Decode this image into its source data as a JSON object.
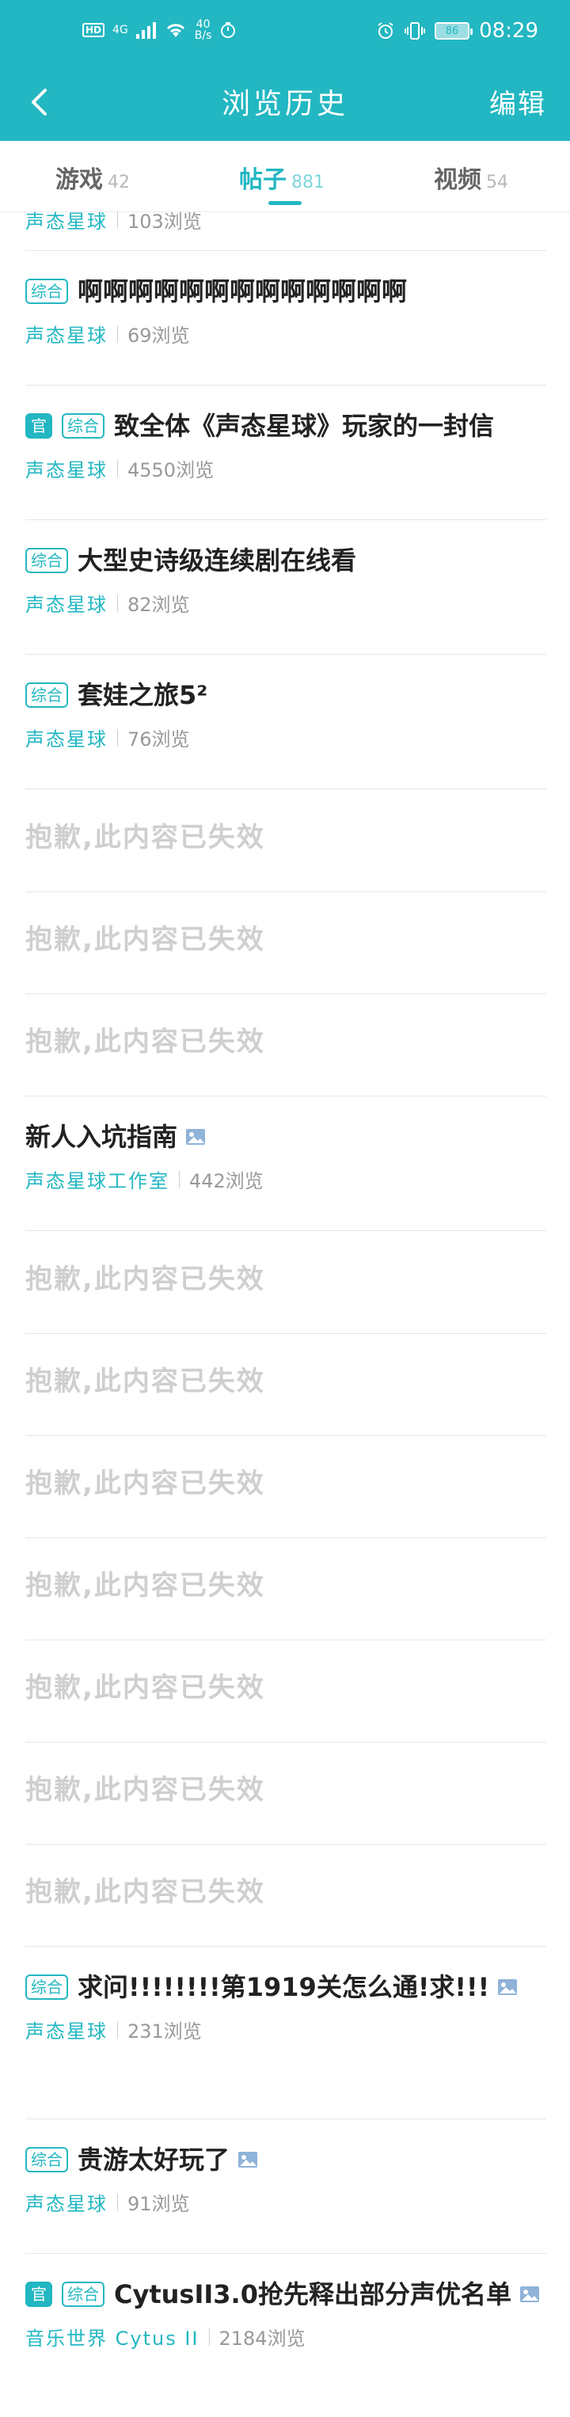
{
  "status_bar": {
    "hd": "HD",
    "signal": "4G",
    "speed_value": "40",
    "speed_unit": "B/s",
    "battery": "86",
    "time": "08:29"
  },
  "header": {
    "title": "浏览历史",
    "edit_label": "编辑"
  },
  "tabs": [
    {
      "label": "游戏",
      "count": "42"
    },
    {
      "label": "帖子",
      "count": "881"
    },
    {
      "label": "视频",
      "count": "54"
    }
  ],
  "active_tab": "帖子",
  "unavailable_text": "抱歉,此内容已失效",
  "posts": [
    {
      "source": "声态星球",
      "views": "103浏览"
    },
    {
      "tags": [
        "综合"
      ],
      "title": "啊啊啊啊啊啊啊啊啊啊啊啊啊",
      "source": "声态星球",
      "views": "69浏览"
    },
    {
      "tags": [
        "官",
        "综合"
      ],
      "title": "致全体《声态星球》玩家的一封信",
      "source": "声态星球",
      "views": "4550浏览"
    },
    {
      "tags": [
        "综合"
      ],
      "title": "大型史诗级连续剧在线看",
      "source": "声态星球",
      "views": "82浏览"
    },
    {
      "tags": [
        "综合"
      ],
      "title": "套娃之旅5²",
      "source": "声态星球",
      "views": "76浏览"
    },
    {
      "title": "新人入坑指南",
      "has_image": true,
      "source": "声态星球工作室",
      "views": "442浏览"
    },
    {
      "tags": [
        "综合"
      ],
      "title": "求问!!!!!!!!第1919关怎么通!求!!!",
      "has_image": true,
      "source": "声态星球",
      "views": "231浏览"
    },
    {
      "tags": [
        "综合"
      ],
      "title": "贵游太好玩了",
      "has_image": true,
      "source": "声态星球",
      "views": "91浏览"
    },
    {
      "tags": [
        "官",
        "综合"
      ],
      "title": "CytusII3.0抢先释出部分声优名单",
      "has_image": true,
      "source": "音乐世界 Cytus II",
      "views": "2184浏览"
    }
  ],
  "colors": {
    "accent": "#22b7c2",
    "muted": "#cfcfcf"
  }
}
